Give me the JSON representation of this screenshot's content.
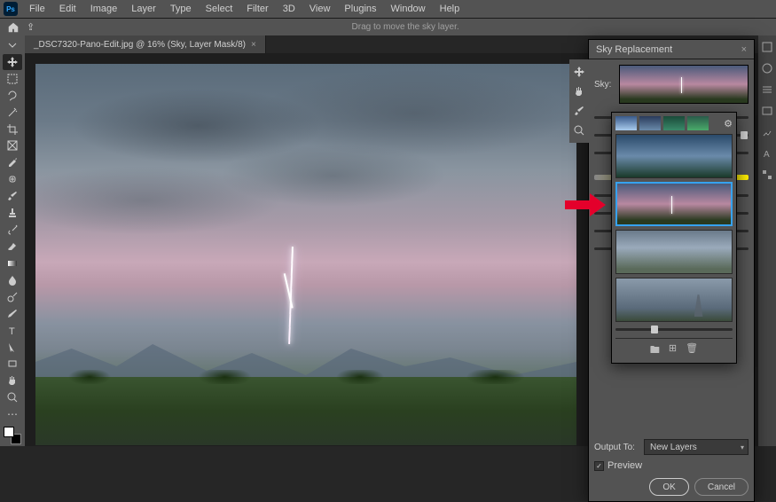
{
  "menubar": [
    "File",
    "Edit",
    "Image",
    "Layer",
    "Type",
    "Select",
    "Filter",
    "3D",
    "View",
    "Plugins",
    "Window",
    "Help"
  ],
  "ps_logo": "Ps",
  "options_hint": "Drag to move the sky layer.",
  "document_tab": {
    "title": "_DSC7320-Pano-Edit.jpg @ 16% (Sky, Layer Mask/8)",
    "close": "×"
  },
  "tools": [
    "move",
    "marquee",
    "lasso",
    "wand",
    "crop",
    "frame",
    "eyedropper",
    "heal",
    "brush",
    "stamp",
    "history",
    "eraser",
    "gradient",
    "blur",
    "dodge",
    "pen",
    "type",
    "path",
    "rect",
    "hand",
    "zoom"
  ],
  "dialog": {
    "title": "Sky Replacement",
    "close": "×",
    "sky_label": "Sky:",
    "output_label": "Output To:",
    "output_value": "New Layers",
    "preview_label": "Preview",
    "preview_checked": "✓",
    "ok": "OK",
    "cancel": "Cancel",
    "picker_icons": {
      "gear": "⚙",
      "folder": "🖿",
      "new": "⊞",
      "trash": "🗑"
    }
  },
  "dlg_tools": [
    "move",
    "hand",
    "color",
    "zoom"
  ]
}
